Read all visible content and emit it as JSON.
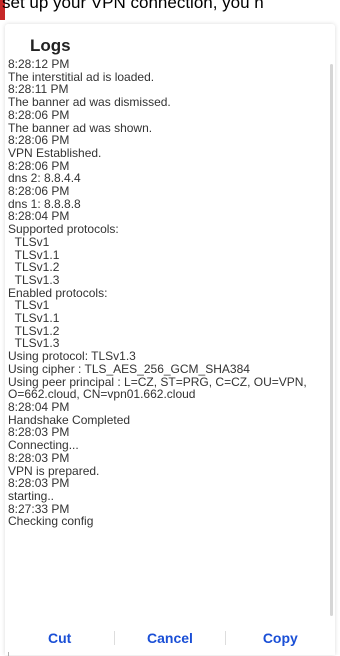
{
  "background": {
    "text": "set up your VPN connection, you n",
    "accent_color": "#c62828"
  },
  "dialog": {
    "title": "Logs",
    "log_lines": [
      "8:28:12 PM",
      "The interstitial ad is loaded.",
      "8:28:11 PM",
      "The banner ad was dismissed.",
      "8:28:06 PM",
      "The banner ad was shown.",
      "8:28:06 PM",
      "VPN Established.",
      "8:28:06 PM",
      "dns 2: 8.8.4.4",
      "8:28:06 PM",
      "dns 1: 8.8.8.8",
      "8:28:04 PM",
      "Supported protocols:",
      "  TLSv1",
      "  TLSv1.1",
      "  TLSv1.2",
      "  TLSv1.3",
      "Enabled protocols:",
      "  TLSv1",
      "  TLSv1.1",
      "  TLSv1.2",
      "  TLSv1.3",
      "Using protocol: TLSv1.3",
      "Using cipher : TLS_AES_256_GCM_SHA384",
      "Using peer principal : L=CZ, ST=PRG, C=CZ, OU=VPN, O=662.cloud, CN=vpn01.662.cloud",
      "8:28:04 PM",
      "Handshake Completed",
      "8:28:03 PM",
      "Connecting...",
      "8:28:03 PM",
      "VPN is prepared.",
      "8:28:03 PM",
      "starting..",
      "8:27:33 PM",
      "Checking config"
    ],
    "buttons": {
      "cut": "Cut",
      "cancel": "Cancel",
      "copy": "Copy"
    },
    "button_color": "#1a4fd6"
  }
}
